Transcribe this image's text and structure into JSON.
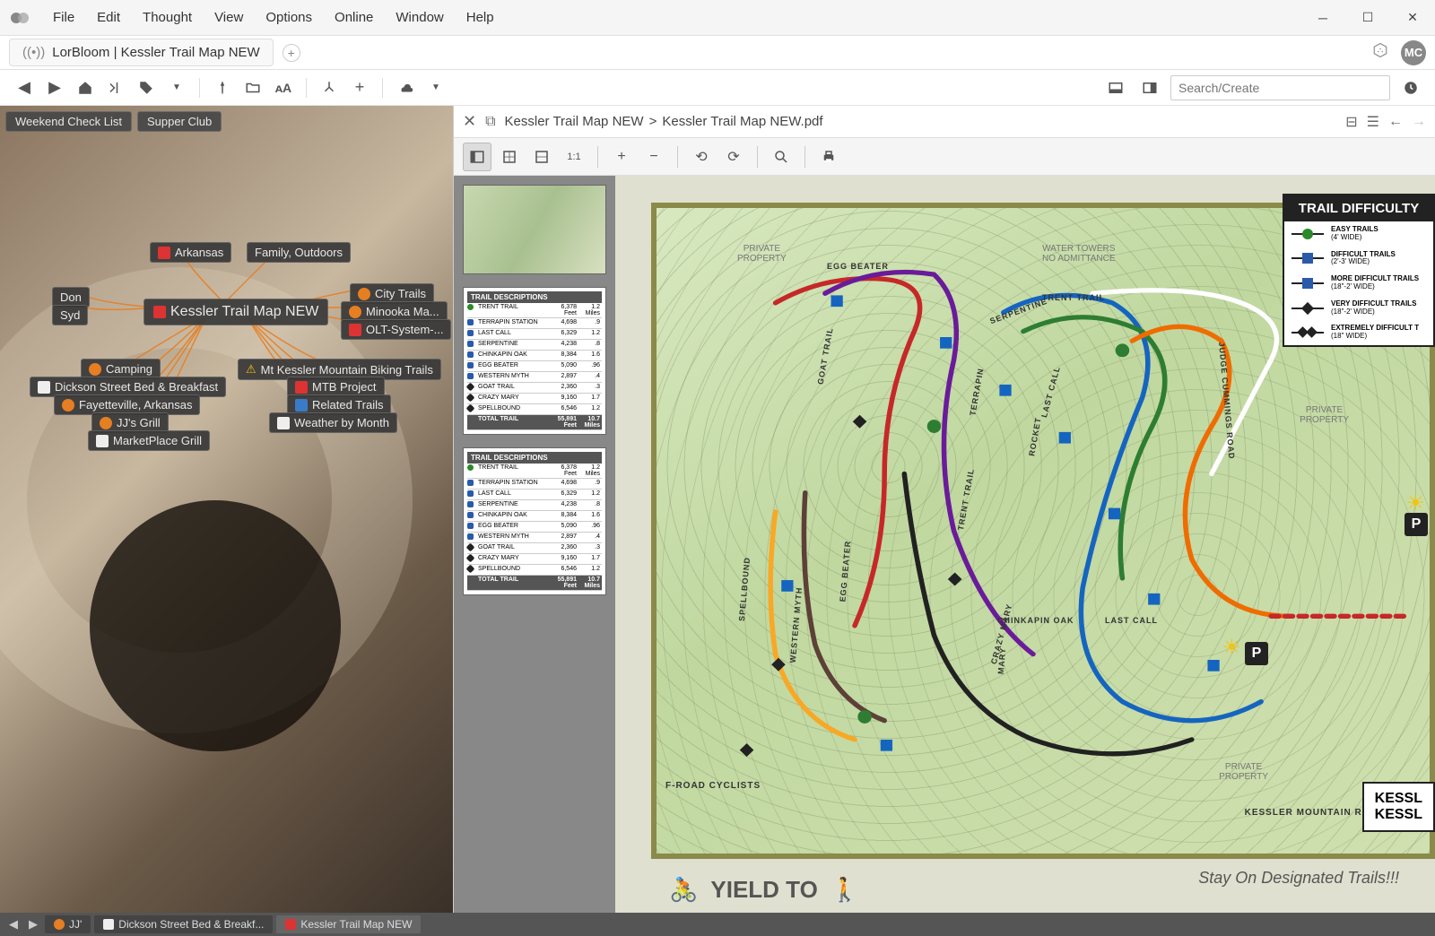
{
  "menu": {
    "file": "File",
    "edit": "Edit",
    "thought": "Thought",
    "view": "View",
    "options": "Options",
    "online": "Online",
    "window": "Window",
    "help": "Help"
  },
  "tab": {
    "title": "LorBloom | Kessler Trail Map NEW"
  },
  "avatar": "MC",
  "search_placeholder": "Search/Create",
  "pins": {
    "a": "Weekend Check List",
    "b": "Supper Club"
  },
  "nodes": {
    "arkansas": "Arkansas",
    "family": "Family, Outdoors",
    "don": "Don",
    "syd": "Syd",
    "main": "Kessler Trail Map NEW",
    "citytrails": "City Trails",
    "minooka": "Minooka Ma...",
    "olt": "OLT-System-...",
    "camping": "Camping",
    "mtkessler": "Mt Kessler Mountain Biking Trails",
    "dickson": "Dickson Street Bed & Breakfast",
    "mtbproject": "MTB Project",
    "fayetteville": "Fayetteville, Arkansas",
    "related": "Related Trails",
    "jjs": "JJ's Grill",
    "weather": "Weather by Month",
    "marketplace": "MarketPlace Grill"
  },
  "pdf": {
    "crumb1": "Kessler Trail Map NEW",
    "crumb_sep": ">",
    "crumb2": "Kessler Trail Map NEW.pdf"
  },
  "trail_table": {
    "header": "TRAIL DESCRIPTIONS",
    "rows": [
      {
        "m": "dg",
        "name": "TRENT TRAIL",
        "dist": "6,378 Feet",
        "mi": "1.2 Miles"
      },
      {
        "m": "db",
        "name": "TERRAPIN STATION",
        "dist": "4,698",
        "mi": ".9"
      },
      {
        "m": "db",
        "name": "LAST CALL",
        "dist": "6,329",
        "mi": "1.2"
      },
      {
        "m": "db",
        "name": "SERPENTINE",
        "dist": "4,238",
        "mi": ".8"
      },
      {
        "m": "db",
        "name": "CHINKAPIN OAK",
        "dist": "8,384",
        "mi": "1.6"
      },
      {
        "m": "db",
        "name": "EGG BEATER",
        "dist": "5,090",
        "mi": ".96"
      },
      {
        "m": "db",
        "name": "WESTERN MYTH",
        "dist": "2,897",
        "mi": ".4"
      },
      {
        "m": "dk",
        "name": "GOAT TRAIL",
        "dist": "2,360",
        "mi": ".3"
      },
      {
        "m": "dk",
        "name": "CRAZY MARY",
        "dist": "9,160",
        "mi": "1.7"
      },
      {
        "m": "dk",
        "name": "SPELLBOUND",
        "dist": "6,546",
        "mi": "1.2"
      },
      {
        "m": "",
        "name": "TOTAL TRAIL",
        "dist": "55,891 Feet",
        "mi": "10.7 Miles"
      }
    ]
  },
  "legend": {
    "title": "TRAIL DIFFICULTY",
    "rows": [
      {
        "name": "EASY TRAILS",
        "sub": "(4' WIDE)"
      },
      {
        "name": "DIFFICULT TRAILS",
        "sub": "(2'-3' WIDE)"
      },
      {
        "name": "MORE  DIFFICULT TRAILS",
        "sub": "(18\"-2' WIDE)"
      },
      {
        "name": "VERY DIFFICULT TRAILS",
        "sub": "(18\"-2' WIDE)"
      },
      {
        "name": "EXTREMELY DIFFICULT T",
        "sub": "(18\" WIDE)"
      }
    ]
  },
  "map": {
    "yield": "YIELD TO",
    "stayon": "Stay On Designated Trails!!!",
    "kess1": "KESSL",
    "kess2": "KESSL",
    "priv": "PRIVATE\nPROPERTY",
    "water": "WATER TOWERS\nNO ADMITTANCE",
    "road1": "KESSLER MOUNTAIN ROAD",
    "road2": "JUDGE CUMMINGS ROAD",
    "offroads": "F-ROAD CYCLISTS",
    "tl_egg": "EGG BEATER",
    "tl_trent": "TRENT  TRAIL",
    "tl_last": "LAST CALL",
    "tl_goat": "GOAT  TRAIL",
    "tl_spell": "SPELLBOUND",
    "tl_western": "WESTERN  MYTH",
    "tl_crazy": "CRAZY  MARY",
    "tl_chin": "CHINKAPIN  OAK",
    "tl_rocket": "ROCKET",
    "tl_terr": "TERRAPIN",
    "tl_serp": "SERPENTINE",
    "tl_mary": "MARY"
  },
  "bottom": {
    "jj": "JJ'",
    "dickson": "Dickson Street Bed & Breakf...",
    "kessler": "Kessler Trail Map NEW"
  }
}
